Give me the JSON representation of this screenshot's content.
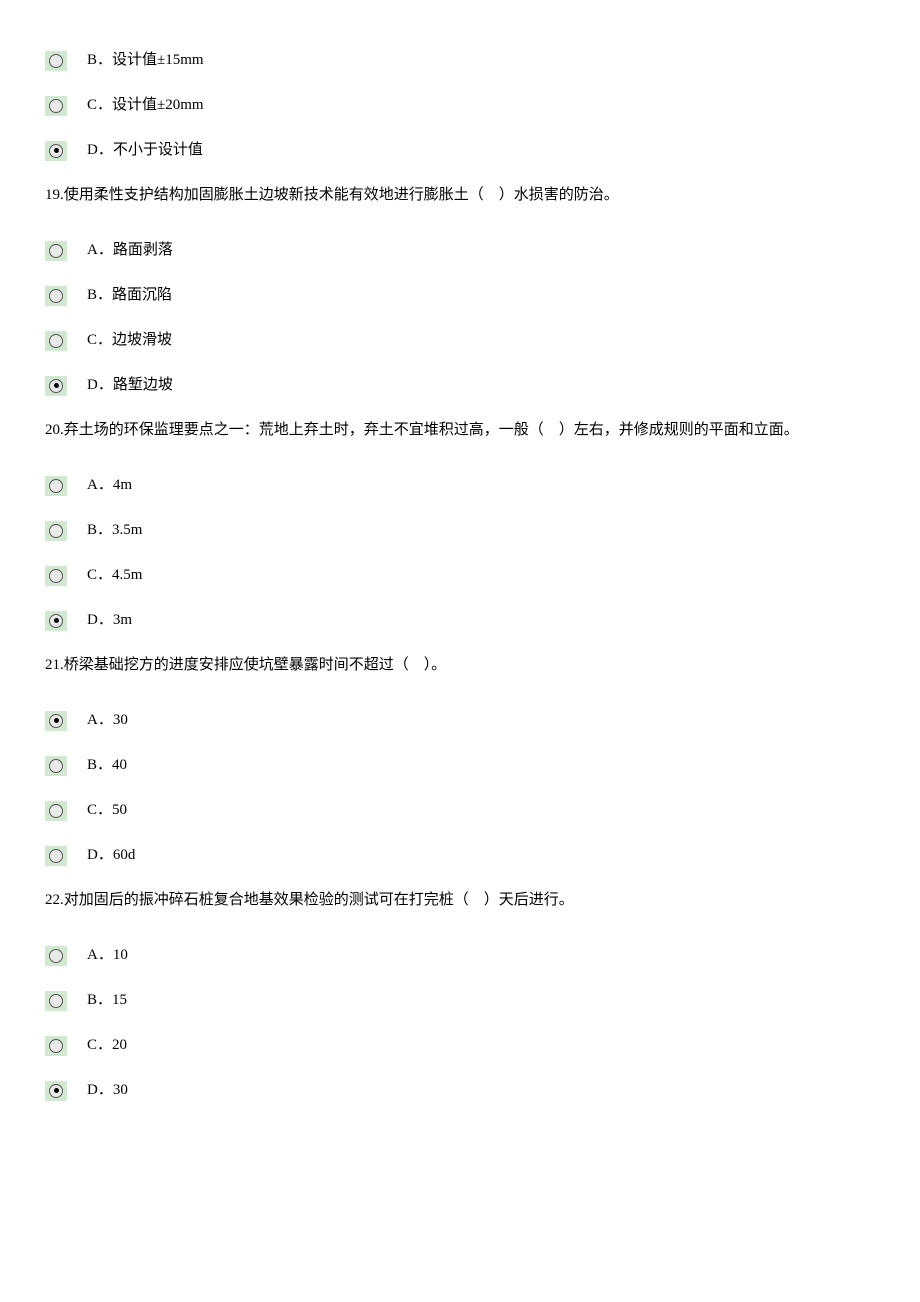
{
  "blocks": [
    {
      "type": "option",
      "selected": false,
      "text": "B．设计值±15mm"
    },
    {
      "type": "option",
      "selected": false,
      "text": "C．设计值±20mm"
    },
    {
      "type": "option",
      "selected": true,
      "text": "D．不小于设计值"
    },
    {
      "type": "question",
      "text": "19.使用柔性支护结构加固膨胀土边坡新技术能有效地进行膨胀土（　）水损害的防治。"
    },
    {
      "type": "option",
      "selected": false,
      "text": "A．路面剥落"
    },
    {
      "type": "option",
      "selected": false,
      "text": "B．路面沉陷"
    },
    {
      "type": "option",
      "selected": false,
      "text": "C．边坡滑坡"
    },
    {
      "type": "option",
      "selected": true,
      "text": "D．路堑边坡"
    },
    {
      "type": "question",
      "text": "20.弃土场的环保监理要点之一：荒地上弃土时，弃土不宜堆积过高，一般（　）左右，并修成规则的平面和立面。"
    },
    {
      "type": "option",
      "selected": false,
      "text": "A．4m"
    },
    {
      "type": "option",
      "selected": false,
      "text": "B．3.5m"
    },
    {
      "type": "option",
      "selected": false,
      "text": "C．4.5m"
    },
    {
      "type": "option",
      "selected": true,
      "text": "D．3m"
    },
    {
      "type": "question",
      "text": "21.桥梁基础挖方的进度安排应使坑壁暴露时间不超过（　）。"
    },
    {
      "type": "option",
      "selected": true,
      "text": "A．30"
    },
    {
      "type": "option",
      "selected": false,
      "text": "B．40"
    },
    {
      "type": "option",
      "selected": false,
      "text": "C．50"
    },
    {
      "type": "option",
      "selected": false,
      "text": "D．60d"
    },
    {
      "type": "question",
      "text": "22.对加固后的振冲碎石桩复合地基效果检验的测试可在打完桩（　）天后进行。"
    },
    {
      "type": "option",
      "selected": false,
      "text": "A．10"
    },
    {
      "type": "option",
      "selected": false,
      "text": "B．15"
    },
    {
      "type": "option",
      "selected": false,
      "text": "C．20"
    },
    {
      "type": "option",
      "selected": true,
      "text": "D．30"
    }
  ]
}
